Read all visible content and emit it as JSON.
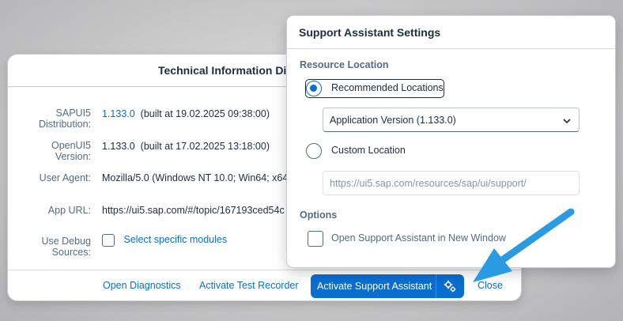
{
  "tech_dialog": {
    "title": "Technical Information Di",
    "rows": [
      {
        "label": "SAPUI5 Distribution:",
        "version": "1.133.0",
        "build": "(built at 19.02.2025 09:38:00)"
      },
      {
        "label": "OpenUI5 Version:",
        "version": "1.133.0",
        "build": "(built at 17.02.2025 13:18:00)"
      },
      {
        "label": "User Agent:",
        "value": "Mozilla/5.0 (Windows NT 10.0; Win64; x64"
      },
      {
        "label": "App URL:",
        "value": "https://ui5.sap.com/#/topic/167193ced54c"
      },
      {
        "label": "Use Debug Sources:",
        "link": "Select specific modules"
      }
    ],
    "footer": {
      "open_diagnostics": "Open Diagnostics",
      "activate_test_recorder": "Activate Test Recorder",
      "activate_support_assistant": "Activate Support Assistant",
      "close": "Close"
    }
  },
  "support_settings": {
    "title": "Support Assistant Settings",
    "resource_location_heading": "Resource Location",
    "recommended_label": "Recommended Locations",
    "recommended_selected": true,
    "select_value": "Application Version (1.133.0)",
    "custom_label": "Custom Location",
    "custom_placeholder": "https://ui5.sap.com/resources/sap/ui/support/",
    "options_heading": "Options",
    "new_window_label": "Open Support Assistant in New Window",
    "new_window_checked": false
  },
  "colors": {
    "accent": "#0a6ed1",
    "annotation_arrow": "#2a9be3"
  },
  "icons": {
    "settings_menu": "gears-icon",
    "dropdown": "chevron-down-icon",
    "annotation": "arrow-annotation"
  }
}
